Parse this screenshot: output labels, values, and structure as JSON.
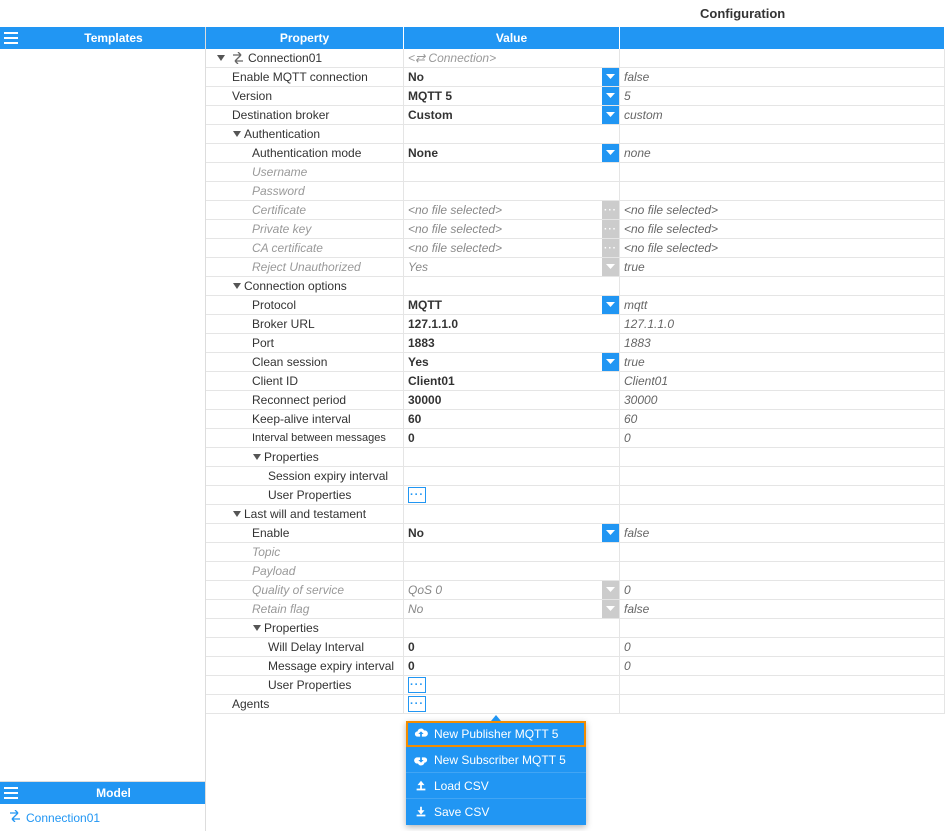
{
  "title": "Configuration",
  "panels": {
    "templates": "Templates",
    "model": "Model"
  },
  "model_items": [
    {
      "label": "Connection01"
    }
  ],
  "grid_headers": {
    "property": "Property",
    "value": "Value"
  },
  "rows": {
    "conn": {
      "label": "Connection01",
      "value": "<⇄ Connection>"
    },
    "emqtt": {
      "label": "Enable MQTT connection",
      "value": "No",
      "def": "false"
    },
    "ver": {
      "label": "Version",
      "value": "MQTT 5",
      "def": "5"
    },
    "broker": {
      "label": "Destination broker",
      "value": "Custom",
      "def": "custom"
    },
    "auth": {
      "label": "Authentication"
    },
    "amode": {
      "label": "Authentication mode",
      "value": "None",
      "def": "none"
    },
    "user": {
      "label": "Username"
    },
    "pass": {
      "label": "Password"
    },
    "cert": {
      "label": "Certificate",
      "value": "<no file selected>",
      "def": "<no file selected>"
    },
    "pkey": {
      "label": "Private key",
      "value": "<no file selected>",
      "def": "<no file selected>"
    },
    "cacert": {
      "label": "CA certificate",
      "value": "<no file selected>",
      "def": "<no file selected>"
    },
    "reject": {
      "label": "Reject Unauthorized",
      "value": "Yes",
      "def": "true"
    },
    "copts": {
      "label": "Connection options"
    },
    "proto": {
      "label": "Protocol",
      "value": "MQTT",
      "def": "mqtt"
    },
    "burl": {
      "label": "Broker URL",
      "value": "127.1.1.0",
      "def": "127.1.1.0"
    },
    "port": {
      "label": "Port",
      "value": "1883",
      "def": "1883"
    },
    "clean": {
      "label": "Clean session",
      "value": "Yes",
      "def": "true"
    },
    "cid": {
      "label": "Client ID",
      "value": "Client01",
      "def": "Client01"
    },
    "recon": {
      "label": "Reconnect period",
      "value": "30000",
      "def": "30000"
    },
    "keep": {
      "label": "Keep-alive interval",
      "value": "60",
      "def": "60"
    },
    "ibm": {
      "label": "Interval between messages",
      "value": "0",
      "def": "0"
    },
    "props1": {
      "label": "Properties"
    },
    "sei": {
      "label": "Session expiry interval"
    },
    "up1": {
      "label": "User Properties"
    },
    "lwt": {
      "label": "Last will and testament"
    },
    "lwt_en": {
      "label": "Enable",
      "value": "No",
      "def": "false"
    },
    "topic": {
      "label": "Topic"
    },
    "payload": {
      "label": "Payload"
    },
    "qos": {
      "label": "Quality of service",
      "value": "QoS 0",
      "def": "0"
    },
    "retain": {
      "label": "Retain flag",
      "value": "No",
      "def": "false"
    },
    "props2": {
      "label": "Properties"
    },
    "wdi": {
      "label": "Will Delay Interval",
      "value": "0",
      "def": "0"
    },
    "mei": {
      "label": "Message expiry interval",
      "value": "0",
      "def": "0"
    },
    "up2": {
      "label": "User Properties"
    },
    "agents": {
      "label": "Agents"
    }
  },
  "menu": {
    "new_pub": "New Publisher MQTT 5",
    "new_sub": "New Subscriber MQTT 5",
    "load_csv": "Load CSV",
    "save_csv": "Save CSV"
  }
}
